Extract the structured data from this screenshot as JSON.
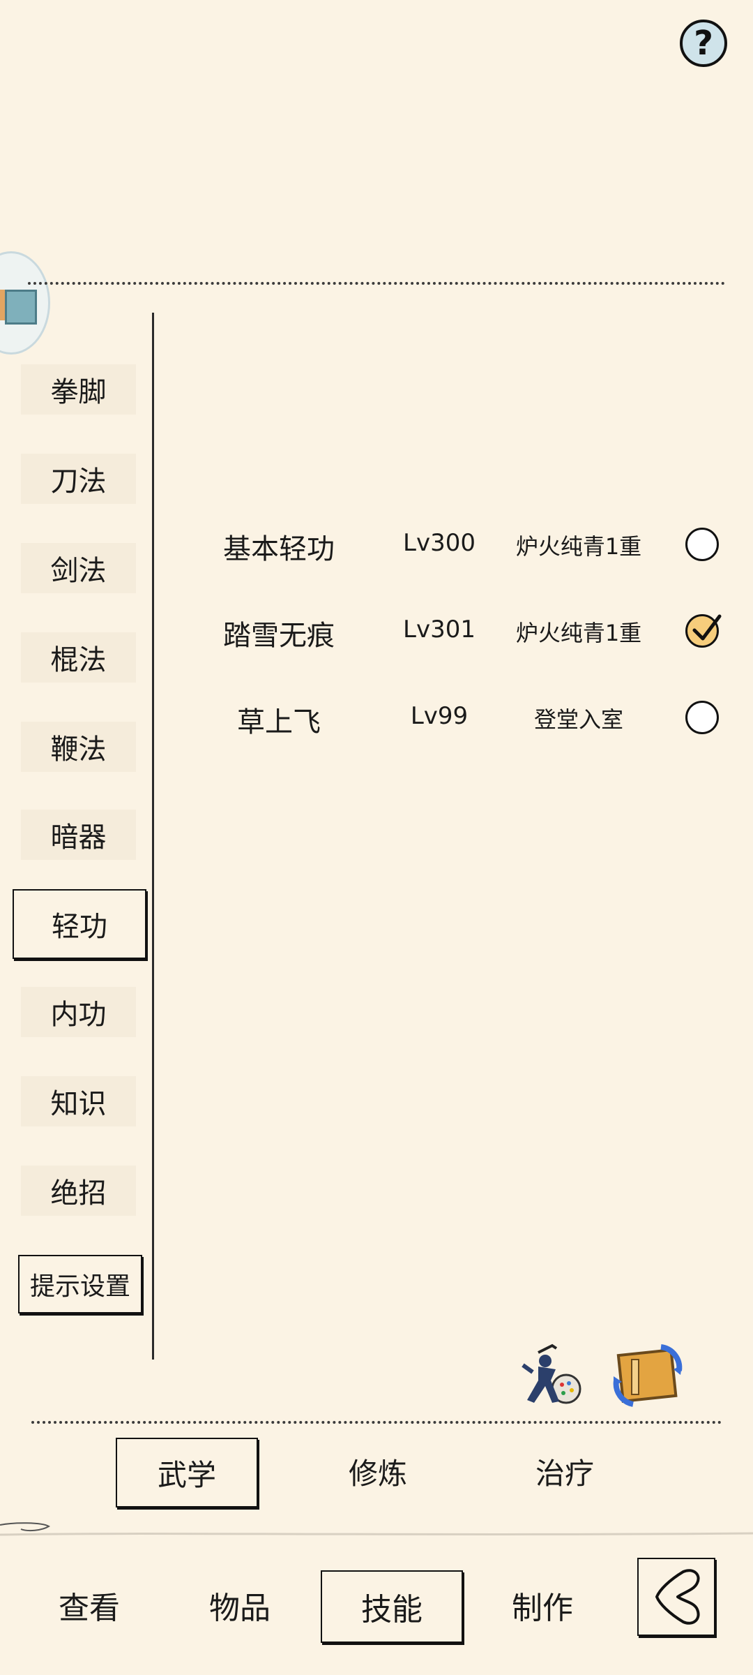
{
  "header": {
    "help_label": "?"
  },
  "sidebar": {
    "items": [
      {
        "label": "拳脚"
      },
      {
        "label": "刀法"
      },
      {
        "label": "剑法"
      },
      {
        "label": "棍法"
      },
      {
        "label": "鞭法"
      },
      {
        "label": "暗器"
      },
      {
        "label": "轻功",
        "active": true
      },
      {
        "label": "内功"
      },
      {
        "label": "知识"
      },
      {
        "label": "绝招"
      }
    ],
    "settings_label": "提示设置"
  },
  "skills": [
    {
      "name": "基本轻功",
      "level": "Lv300",
      "stage": "炉火纯青1重",
      "selected": false
    },
    {
      "name": "踏雪无痕",
      "level": "Lv301",
      "stage": "炉火纯青1重",
      "selected": true
    },
    {
      "name": "草上飞",
      "level": "Lv99",
      "stage": "登堂入室",
      "selected": false
    }
  ],
  "subtabs": [
    {
      "label": "武学",
      "active": true
    },
    {
      "label": "修炼"
    },
    {
      "label": "治疗"
    }
  ],
  "nav": [
    {
      "label": "查看"
    },
    {
      "label": "物品"
    },
    {
      "label": "技能",
      "active": true
    },
    {
      "label": "制作"
    }
  ],
  "icons": {
    "help": "question-icon",
    "avatar": "avatar-badge",
    "ninja": "ninja-palette-icon",
    "swap": "swap-scroll-icon",
    "back": "back-arrow-icon"
  },
  "colors": {
    "background": "#FBF3E4",
    "checked_fill": "#f6cd7c",
    "help_fill": "#cfe3ea"
  }
}
